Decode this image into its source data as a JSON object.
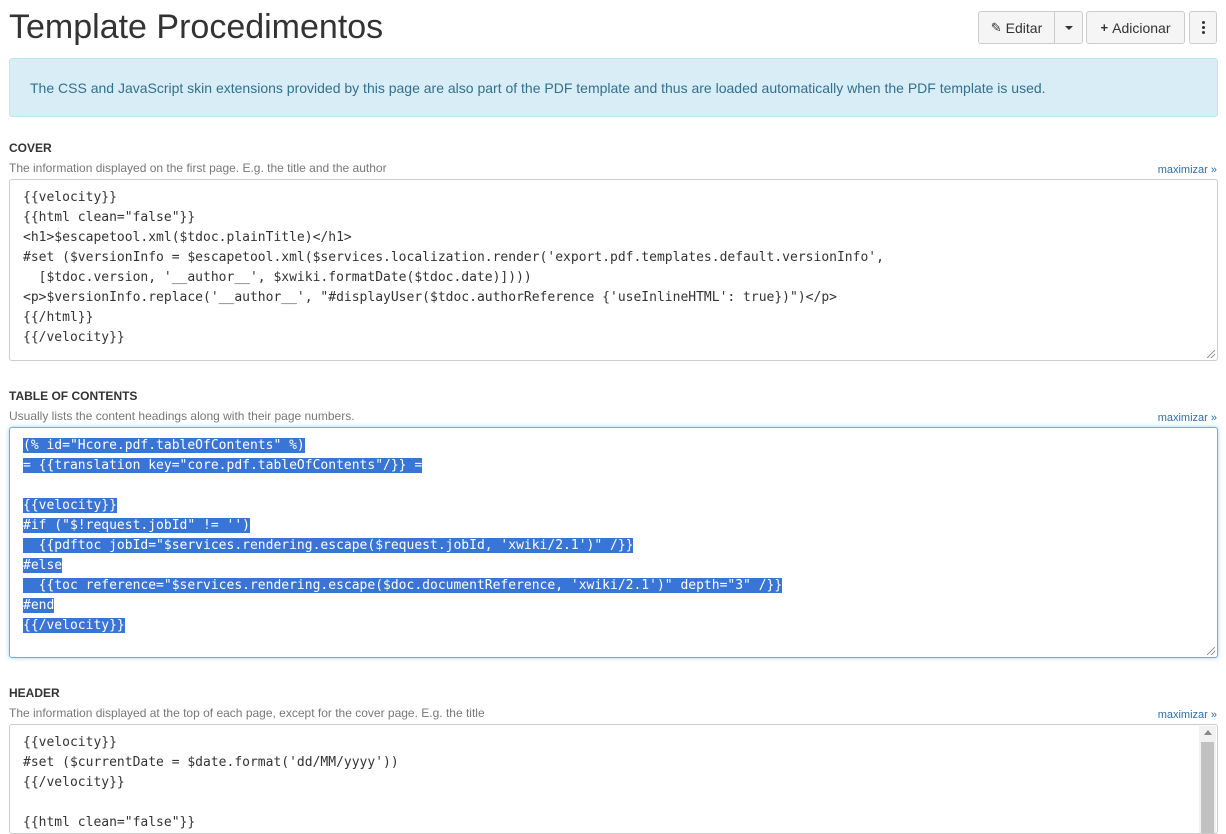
{
  "page": {
    "title": "Template Procedimentos"
  },
  "toolbar": {
    "edit_label": "Editar",
    "add_label": "Adicionar"
  },
  "info": {
    "message": "The CSS and JavaScript skin extensions provided by this page are also part of the PDF template and thus are loaded automatically when the PDF template is used."
  },
  "sections": {
    "cover": {
      "label": "COVER",
      "hint": "The information displayed on the first page. E.g. the title and the author",
      "maximize": "maximizar »",
      "lines": [
        "{{velocity}}",
        "{{html clean=\"false\"}}",
        "<h1>$escapetool.xml($tdoc.plainTitle)</h1>",
        "#set ($versionInfo = $escapetool.xml($services.localization.render('export.pdf.templates.default.versionInfo',",
        "  [$tdoc.version, '__author__', $xwiki.formatDate($tdoc.date)])))",
        "<p>$versionInfo.replace('__author__', \"#displayUser($tdoc.authorReference {'useInlineHTML': true})\")</p>",
        "{{/html}}",
        "{{/velocity}}"
      ]
    },
    "toc": {
      "label": "TABLE OF CONTENTS",
      "hint": "Usually lists the content headings along with their page numbers.",
      "maximize": "maximizar »",
      "lines": [
        "(% id=\"Hcore.pdf.tableOfContents\" %)",
        "= {{translation key=\"core.pdf.tableOfContents\"/}} =",
        "",
        "{{velocity}}",
        "#if (\"$!request.jobId\" != '')",
        "  {{pdftoc jobId=\"$services.rendering.escape($request.jobId, 'xwiki/2.1')\" /}}",
        "#else",
        "  {{toc reference=\"$services.rendering.escape($doc.documentReference, 'xwiki/2.1')\" depth=\"3\" /}}",
        "#end",
        "{{/velocity}}"
      ]
    },
    "header": {
      "label": "HEADER",
      "hint": "The information displayed at the top of each page, except for the cover page. E.g. the title",
      "maximize": "maximizar »",
      "lines": [
        "{{velocity}}",
        "#set ($currentDate = $date.format('dd/MM/yyyy'))",
        "{{/velocity}}",
        "",
        "{{html clean=\"false\"}}"
      ]
    }
  }
}
